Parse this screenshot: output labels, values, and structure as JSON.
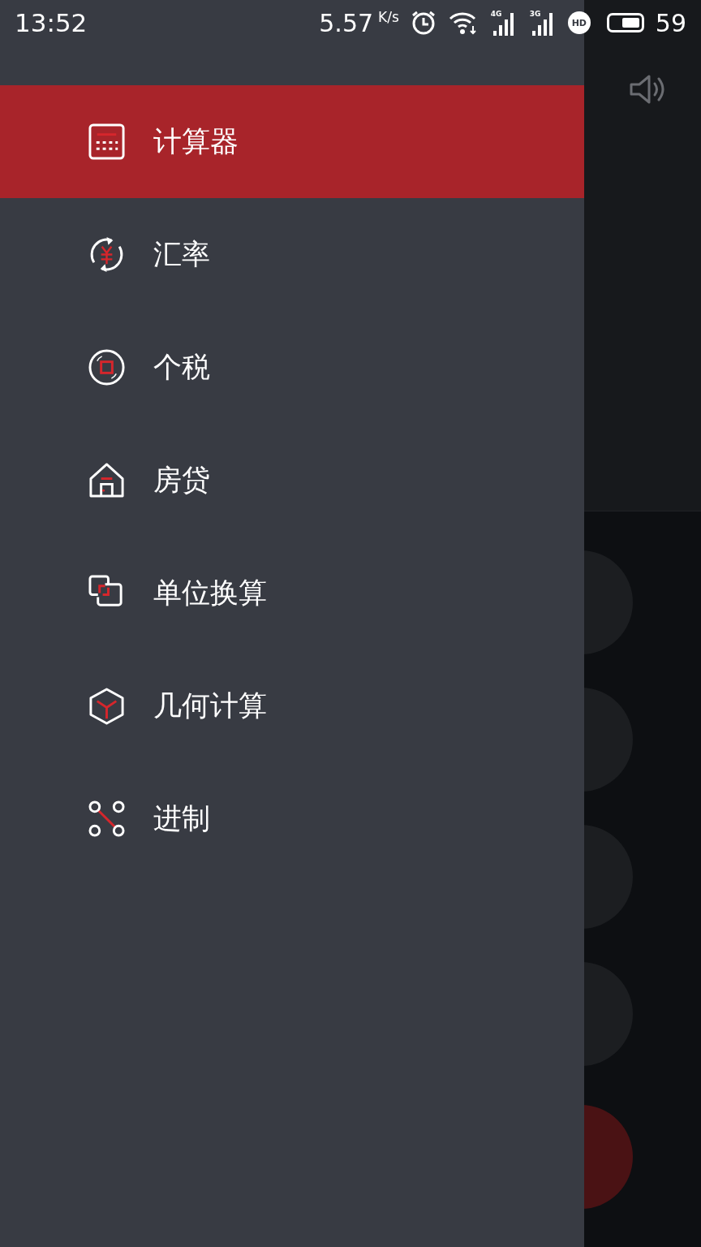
{
  "status_bar": {
    "time": "13:52",
    "speed": "5.57",
    "speed_unit": "K/s",
    "networks": [
      "4G",
      "3G"
    ],
    "hd_label": "HD",
    "battery": "59"
  },
  "drawer": {
    "items": [
      {
        "label": "计算器",
        "selected": true
      },
      {
        "label": "汇率",
        "selected": false
      },
      {
        "label": "个税",
        "selected": false
      },
      {
        "label": "房贷",
        "selected": false
      },
      {
        "label": "单位换算",
        "selected": false
      },
      {
        "label": "几何计算",
        "selected": false
      },
      {
        "label": "进制",
        "selected": false
      }
    ]
  }
}
